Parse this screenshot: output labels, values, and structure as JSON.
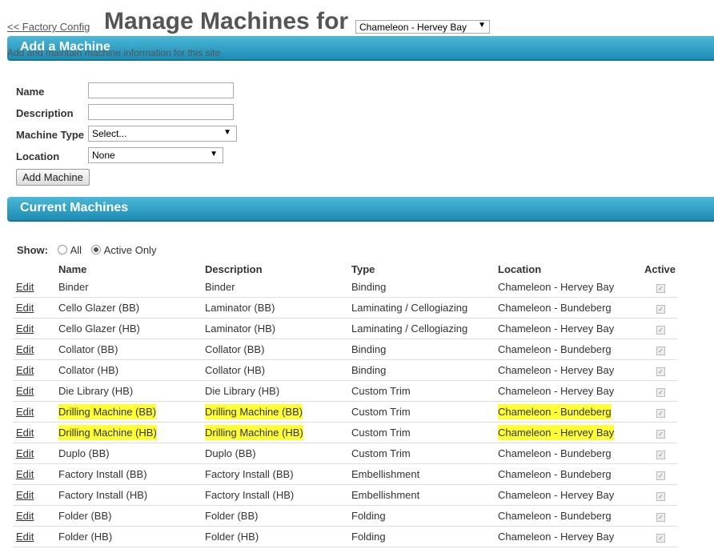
{
  "header": {
    "back_link": "<< Factory Config",
    "title": "Manage Machines for",
    "site_selected": "Chameleon - Hervey Bay"
  },
  "add_section": {
    "title": "Add a Machine",
    "subtitle": "Add and maintain machine information for this site",
    "name_label": "Name",
    "description_label": "Description",
    "type_label": "Machine Type",
    "type_value": "Select...",
    "location_label": "Location",
    "location_value": "None",
    "add_button": "Add Machine"
  },
  "current_section": {
    "title": "Current Machines",
    "show_label": "Show:",
    "filter_all": "All",
    "filter_active": "Active Only",
    "columns": [
      "",
      "Name",
      "Description",
      "Type",
      "Location",
      "Active"
    ],
    "edit_label": "Edit",
    "rows": [
      {
        "name": "Binder",
        "description": "Binder",
        "type": "Binding",
        "location": "Chameleon - Hervey Bay",
        "active": true,
        "highlight": false
      },
      {
        "name": "Cello Glazer (BB)",
        "description": "Laminator (BB)",
        "type": "Laminating / Cellogiazing",
        "location": "Chameleon - Bundeberg",
        "active": true,
        "highlight": false
      },
      {
        "name": "Cello Glazer (HB)",
        "description": "Laminator (HB)",
        "type": "Laminating / Cellogiazing",
        "location": "Chameleon - Hervey Bay",
        "active": true,
        "highlight": false
      },
      {
        "name": "Collator (BB)",
        "description": "Collator (BB)",
        "type": "Binding",
        "location": "Chameleon - Bundeberg",
        "active": true,
        "highlight": false
      },
      {
        "name": "Collator (HB)",
        "description": "Collator (HB)",
        "type": "Binding",
        "location": "Chameleon - Hervey Bay",
        "active": true,
        "highlight": false
      },
      {
        "name": "Die Library (HB)",
        "description": "Die Library (HB)",
        "type": "Custom Trim",
        "location": "Chameleon - Hervey Bay",
        "active": true,
        "highlight": false
      },
      {
        "name": "Drilling Machine (BB)",
        "description": "Drilling Machine (BB)",
        "type": "Custom Trim",
        "location": "Chameleon - Bundeberg",
        "active": true,
        "highlight": true
      },
      {
        "name": "Drilling Machine (HB)",
        "description": "Drilling Machine (HB)",
        "type": "Custom Trim",
        "location": "Chameleon - Hervey Bay",
        "active": true,
        "highlight": true
      },
      {
        "name": "Duplo (BB)",
        "description": "Duplo (BB)",
        "type": "Custom Trim",
        "location": "Chameleon - Bundeberg",
        "active": true,
        "highlight": false
      },
      {
        "name": "Factory Install (BB)",
        "description": "Factory Install (BB)",
        "type": "Embellishment",
        "location": "Chameleon - Bundeberg",
        "active": true,
        "highlight": false
      },
      {
        "name": "Factory Install (HB)",
        "description": "Factory Install (HB)",
        "type": "Embellishment",
        "location": "Chameleon - Hervey Bay",
        "active": true,
        "highlight": false
      },
      {
        "name": "Folder (BB)",
        "description": "Folder (BB)",
        "type": "Folding",
        "location": "Chameleon - Bundeberg",
        "active": true,
        "highlight": false
      },
      {
        "name": "Folder (HB)",
        "description": "Folder (HB)",
        "type": "Folding",
        "location": "Chameleon - Hervey Bay",
        "active": true,
        "highlight": false
      }
    ]
  },
  "colors": {
    "band_top": "#4bb8d8",
    "band_bottom": "#1e8cb4",
    "highlight": "#ffff33"
  }
}
